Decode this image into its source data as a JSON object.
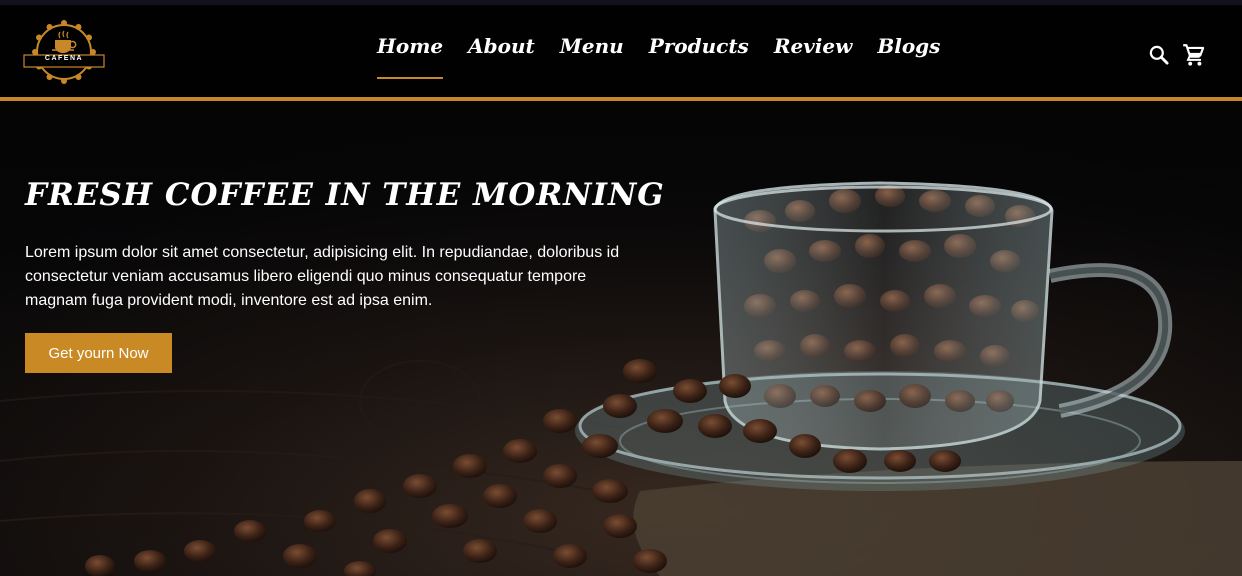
{
  "brand": {
    "logo_text": "CAFENA",
    "accent_color": "#c8882a",
    "button_color": "#c98a26"
  },
  "nav": {
    "items": [
      {
        "label": "Home",
        "active": true
      },
      {
        "label": "About"
      },
      {
        "label": "Menu"
      },
      {
        "label": "Products"
      },
      {
        "label": "Review"
      },
      {
        "label": "Blogs"
      }
    ]
  },
  "header_icons": {
    "search": "search-icon",
    "cart": "cart-icon"
  },
  "hero": {
    "title": "FRESH COFFEE IN THE MORNING",
    "description": "Lorem ipsum dolor sit amet consectetur, adipisicing elit. In repudiandae, doloribus id consectetur veniam accusamus libero eligendi quo minus consequatur tempore magnam fuga provident modi, inventore est ad ipsa enim.",
    "cta_label": "Get yourn Now",
    "image": "coffee-beans-in-glass-cup-photo"
  }
}
